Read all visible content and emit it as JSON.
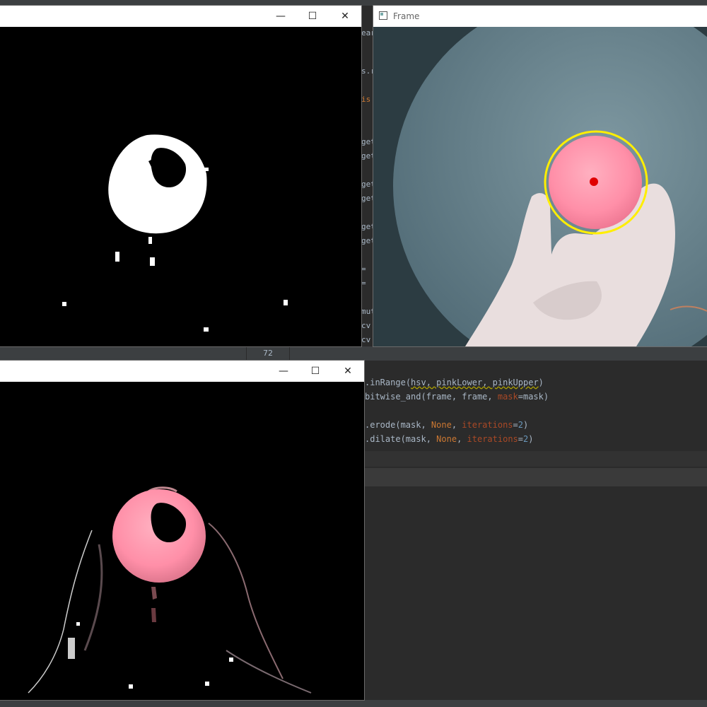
{
  "ide": {
    "line_number": "72",
    "left_gutter_fragments": [
      "ear",
      "s.r",
      "is",
      "get",
      "get",
      "get",
      "get",
      "get",
      "get",
      "= ",
      "= ",
      "mut",
      "cv",
      "cv"
    ],
    "code_lines": [
      {
        "prefix": ".",
        "fn": "inRange",
        "open": "(",
        "args": "hsv, pinkLower, pinkUpper",
        "close": ")"
      },
      {
        "text_a": "bitwise_and(frame, frame, ",
        "param": "mask",
        "text_b": "=mask)"
      },
      {
        "text_a": ".erode(mask, ",
        "none": "None",
        "mid": ", ",
        "param": "iterations",
        "eq": "=",
        "num": "2",
        "end": ")"
      },
      {
        "text_a": ".dilate(mask, ",
        "none": "None",
        "mid": ", ",
        "param": "iterations",
        "eq": "=",
        "num": "2",
        "end": ")"
      }
    ]
  },
  "windows": {
    "mask": {
      "minimize_glyph": "—",
      "maximize_glyph": "☐",
      "close_glyph": "✕"
    },
    "frame": {
      "title": "Frame",
      "icon": "opencv-window-icon"
    },
    "result": {
      "minimize_glyph": "—",
      "maximize_glyph": "☐",
      "close_glyph": "✕"
    }
  },
  "colors": {
    "ide_bg": "#2b2b2b",
    "ball_pink": "#ff8fa8",
    "tracking_circle": "#ffee00",
    "center_dot": "#e00000"
  }
}
